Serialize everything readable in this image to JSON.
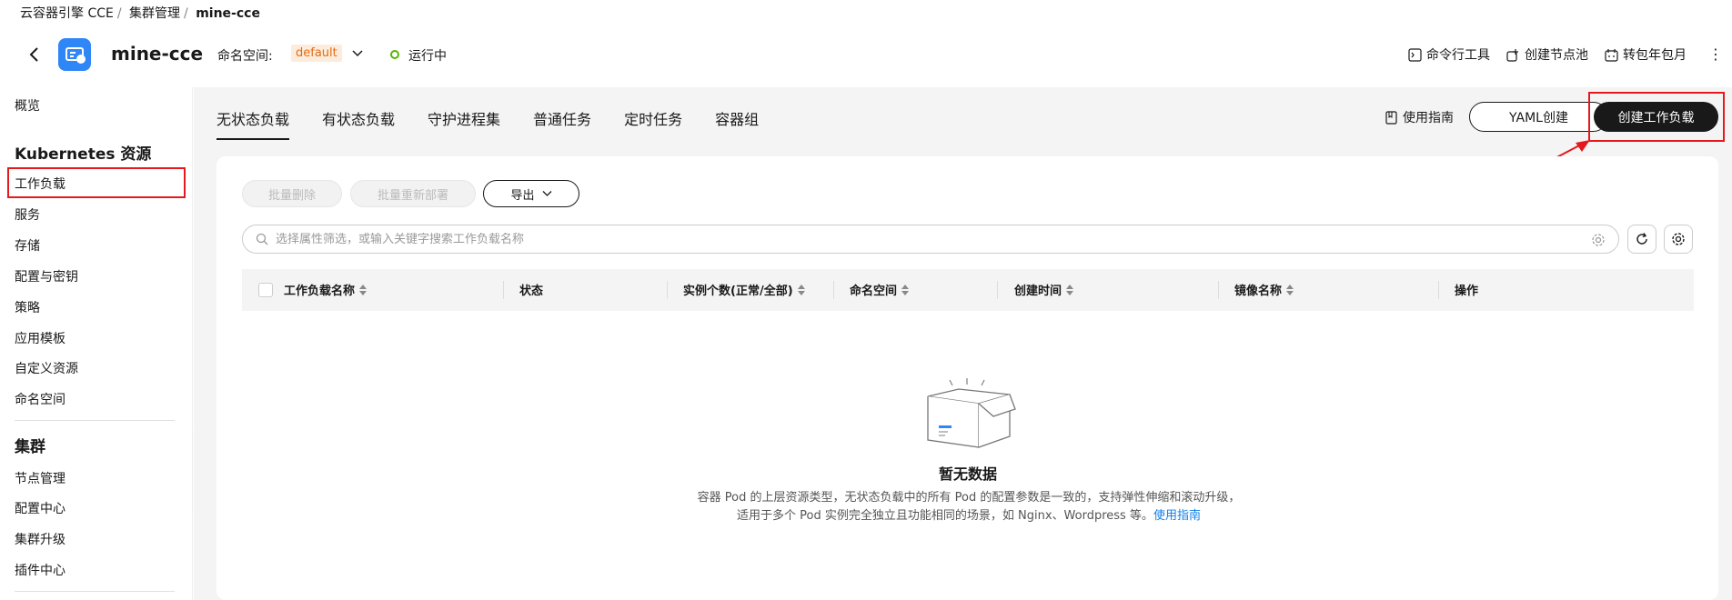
{
  "breadcrumb": [
    "云容器引擎 CCE",
    "集群管理",
    "mine-cce"
  ],
  "header": {
    "cluster_name": "mine-cce",
    "namespace_label": "命名空间:",
    "namespace_value": "default",
    "status": "运行中",
    "actions": [
      "命令行工具",
      "创建节点池",
      "转包年包月"
    ]
  },
  "sidebar": {
    "overview": "概览",
    "k8s_group": "Kubernetes 资源",
    "k8s_items": [
      "工作负载",
      "服务",
      "存储",
      "配置与密钥",
      "策略",
      "应用模板",
      "自定义资源",
      "命名空间"
    ],
    "cluster_group": "集群",
    "cluster_items": [
      "节点管理",
      "配置中心",
      "集群升级",
      "插件中心"
    ]
  },
  "tabs": [
    "无状态负载",
    "有状态负载",
    "守护进程集",
    "普通任务",
    "定时任务",
    "容器组"
  ],
  "toolbar": {
    "guide": "使用指南",
    "yaml_create": "YAML创建",
    "create_workload": "创建工作负载",
    "batch_delete": "批量删除",
    "batch_redeploy": "批量重新部署",
    "export": "导出"
  },
  "search": {
    "placeholder": "选择属性筛选，或输入关键字搜索工作负载名称"
  },
  "table": {
    "columns": [
      "工作负载名称",
      "状态",
      "实例个数(正常/全部)",
      "命名空间",
      "创建时间",
      "镜像名称",
      "操作"
    ]
  },
  "empty": {
    "title": "暂无数据",
    "desc_line1": "容器 Pod 的上层资源类型，无状态负载中的所有 Pod 的配置参数是一致的，支持弹性伸缩和滚动升级，",
    "desc_line2": "适用于多个 Pod 实例完全独立且功能相同的场景，如 Nginx、Wordpress 等。",
    "link": "使用指南"
  },
  "colors": {
    "primary_dark": "#191919",
    "highlight_red": "#e5191d",
    "status_green": "#5bb300",
    "namespace_orange": "#e26b17",
    "link_blue": "#0e7fea"
  }
}
